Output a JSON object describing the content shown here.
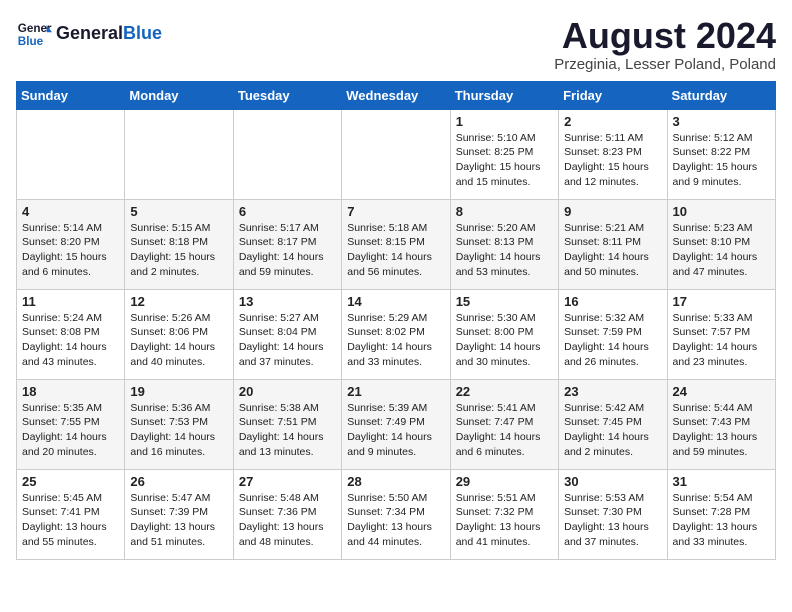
{
  "header": {
    "logo_general": "General",
    "logo_blue": "Blue",
    "month_title": "August 2024",
    "location": "Przeginia, Lesser Poland, Poland"
  },
  "days_of_week": [
    "Sunday",
    "Monday",
    "Tuesday",
    "Wednesday",
    "Thursday",
    "Friday",
    "Saturday"
  ],
  "weeks": [
    [
      {
        "day": "",
        "info": ""
      },
      {
        "day": "",
        "info": ""
      },
      {
        "day": "",
        "info": ""
      },
      {
        "day": "",
        "info": ""
      },
      {
        "day": "1",
        "info": "Sunrise: 5:10 AM\nSunset: 8:25 PM\nDaylight: 15 hours\nand 15 minutes."
      },
      {
        "day": "2",
        "info": "Sunrise: 5:11 AM\nSunset: 8:23 PM\nDaylight: 15 hours\nand 12 minutes."
      },
      {
        "day": "3",
        "info": "Sunrise: 5:12 AM\nSunset: 8:22 PM\nDaylight: 15 hours\nand 9 minutes."
      }
    ],
    [
      {
        "day": "4",
        "info": "Sunrise: 5:14 AM\nSunset: 8:20 PM\nDaylight: 15 hours\nand 6 minutes."
      },
      {
        "day": "5",
        "info": "Sunrise: 5:15 AM\nSunset: 8:18 PM\nDaylight: 15 hours\nand 2 minutes."
      },
      {
        "day": "6",
        "info": "Sunrise: 5:17 AM\nSunset: 8:17 PM\nDaylight: 14 hours\nand 59 minutes."
      },
      {
        "day": "7",
        "info": "Sunrise: 5:18 AM\nSunset: 8:15 PM\nDaylight: 14 hours\nand 56 minutes."
      },
      {
        "day": "8",
        "info": "Sunrise: 5:20 AM\nSunset: 8:13 PM\nDaylight: 14 hours\nand 53 minutes."
      },
      {
        "day": "9",
        "info": "Sunrise: 5:21 AM\nSunset: 8:11 PM\nDaylight: 14 hours\nand 50 minutes."
      },
      {
        "day": "10",
        "info": "Sunrise: 5:23 AM\nSunset: 8:10 PM\nDaylight: 14 hours\nand 47 minutes."
      }
    ],
    [
      {
        "day": "11",
        "info": "Sunrise: 5:24 AM\nSunset: 8:08 PM\nDaylight: 14 hours\nand 43 minutes."
      },
      {
        "day": "12",
        "info": "Sunrise: 5:26 AM\nSunset: 8:06 PM\nDaylight: 14 hours\nand 40 minutes."
      },
      {
        "day": "13",
        "info": "Sunrise: 5:27 AM\nSunset: 8:04 PM\nDaylight: 14 hours\nand 37 minutes."
      },
      {
        "day": "14",
        "info": "Sunrise: 5:29 AM\nSunset: 8:02 PM\nDaylight: 14 hours\nand 33 minutes."
      },
      {
        "day": "15",
        "info": "Sunrise: 5:30 AM\nSunset: 8:00 PM\nDaylight: 14 hours\nand 30 minutes."
      },
      {
        "day": "16",
        "info": "Sunrise: 5:32 AM\nSunset: 7:59 PM\nDaylight: 14 hours\nand 26 minutes."
      },
      {
        "day": "17",
        "info": "Sunrise: 5:33 AM\nSunset: 7:57 PM\nDaylight: 14 hours\nand 23 minutes."
      }
    ],
    [
      {
        "day": "18",
        "info": "Sunrise: 5:35 AM\nSunset: 7:55 PM\nDaylight: 14 hours\nand 20 minutes."
      },
      {
        "day": "19",
        "info": "Sunrise: 5:36 AM\nSunset: 7:53 PM\nDaylight: 14 hours\nand 16 minutes."
      },
      {
        "day": "20",
        "info": "Sunrise: 5:38 AM\nSunset: 7:51 PM\nDaylight: 14 hours\nand 13 minutes."
      },
      {
        "day": "21",
        "info": "Sunrise: 5:39 AM\nSunset: 7:49 PM\nDaylight: 14 hours\nand 9 minutes."
      },
      {
        "day": "22",
        "info": "Sunrise: 5:41 AM\nSunset: 7:47 PM\nDaylight: 14 hours\nand 6 minutes."
      },
      {
        "day": "23",
        "info": "Sunrise: 5:42 AM\nSunset: 7:45 PM\nDaylight: 14 hours\nand 2 minutes."
      },
      {
        "day": "24",
        "info": "Sunrise: 5:44 AM\nSunset: 7:43 PM\nDaylight: 13 hours\nand 59 minutes."
      }
    ],
    [
      {
        "day": "25",
        "info": "Sunrise: 5:45 AM\nSunset: 7:41 PM\nDaylight: 13 hours\nand 55 minutes."
      },
      {
        "day": "26",
        "info": "Sunrise: 5:47 AM\nSunset: 7:39 PM\nDaylight: 13 hours\nand 51 minutes."
      },
      {
        "day": "27",
        "info": "Sunrise: 5:48 AM\nSunset: 7:36 PM\nDaylight: 13 hours\nand 48 minutes."
      },
      {
        "day": "28",
        "info": "Sunrise: 5:50 AM\nSunset: 7:34 PM\nDaylight: 13 hours\nand 44 minutes."
      },
      {
        "day": "29",
        "info": "Sunrise: 5:51 AM\nSunset: 7:32 PM\nDaylight: 13 hours\nand 41 minutes."
      },
      {
        "day": "30",
        "info": "Sunrise: 5:53 AM\nSunset: 7:30 PM\nDaylight: 13 hours\nand 37 minutes."
      },
      {
        "day": "31",
        "info": "Sunrise: 5:54 AM\nSunset: 7:28 PM\nDaylight: 13 hours\nand 33 minutes."
      }
    ]
  ]
}
